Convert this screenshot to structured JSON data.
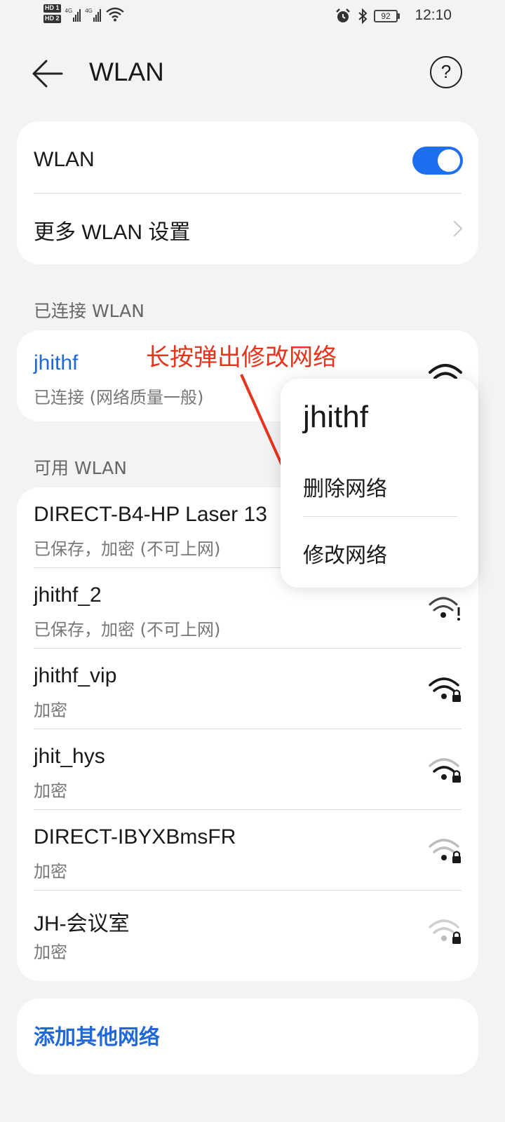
{
  "status_bar": {
    "hd_badges": [
      "HD 1",
      "HD 2"
    ],
    "signal_labels": [
      "4G",
      "4G"
    ],
    "battery": "92",
    "time": "12:10"
  },
  "header": {
    "title": "WLAN",
    "help": "?"
  },
  "main_card": {
    "wlan_label": "WLAN",
    "wlan_enabled": true,
    "more_settings_label": "更多 WLAN 设置"
  },
  "connected_section": {
    "label": "已连接 WLAN",
    "network": {
      "name": "jhithf",
      "status": "已连接 (网络质量一般)"
    }
  },
  "annotation": "长按弹出修改网络",
  "popup": {
    "title": "jhithf",
    "items": [
      "删除网络",
      "修改网络"
    ]
  },
  "available_section": {
    "label": "可用 WLAN",
    "networks": [
      {
        "name": "DIRECT-B4-HP Laser 13",
        "status": "已保存，加密 (不可上网)"
      },
      {
        "name": "jhithf_2",
        "status": "已保存，加密 (不可上网)"
      },
      {
        "name": "jhithf_vip",
        "status": "加密"
      },
      {
        "name": "jhit_hys",
        "status": "加密"
      },
      {
        "name": "DIRECT-IBYXBmsFR",
        "status": "加密"
      },
      {
        "name": "JH-会议室",
        "status": "加密"
      }
    ]
  },
  "add_network": {
    "label": "添加其他网络"
  },
  "colors": {
    "accent": "#1e6ef0",
    "link": "#2067d8",
    "annotation": "#e8341c"
  }
}
